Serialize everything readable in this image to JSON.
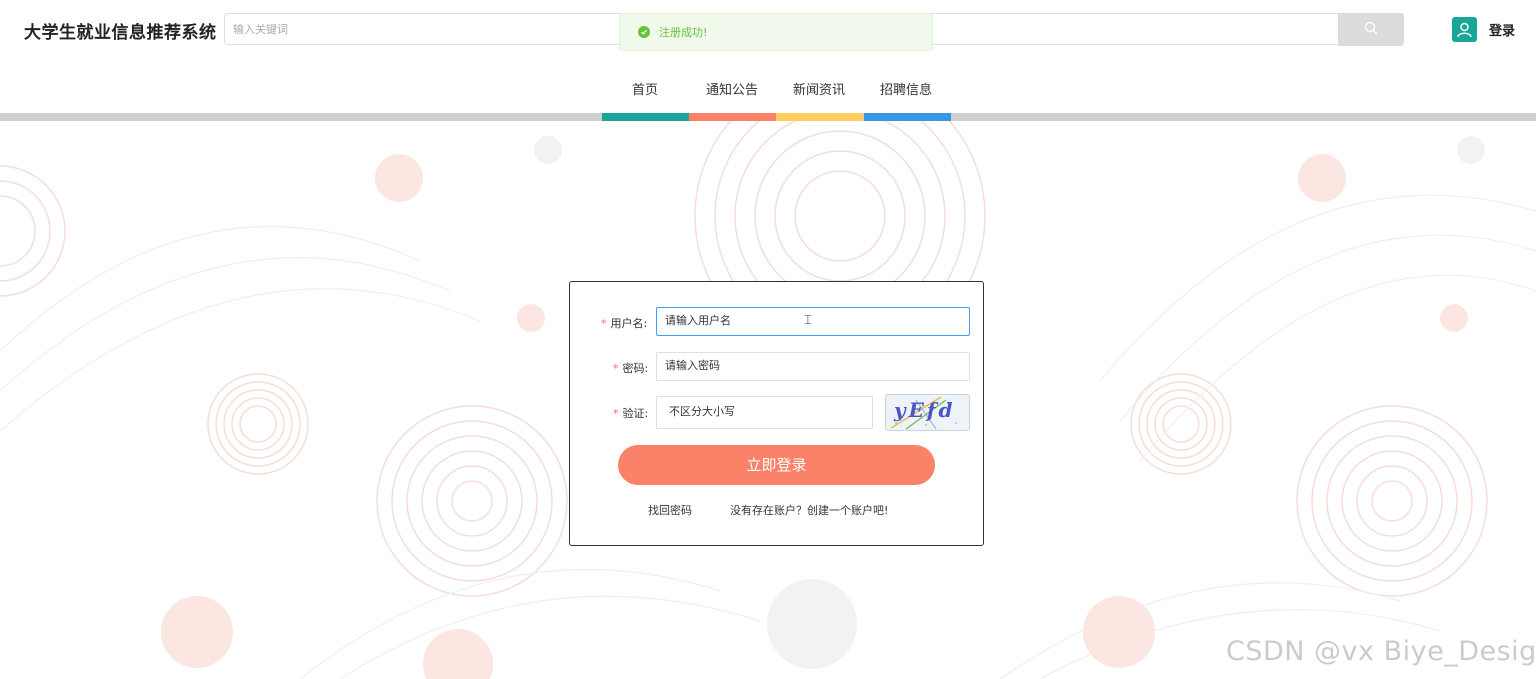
{
  "header": {
    "title": "大学生就业信息推荐系统",
    "search_placeholder": "输入关键词",
    "login_label": "登录"
  },
  "toast": {
    "message": "注册成功!"
  },
  "nav": {
    "items": [
      {
        "label": "首页",
        "color": "#19a699"
      },
      {
        "label": "通知公告",
        "color": "#fa8268"
      },
      {
        "label": "新闻资讯",
        "color": "#ffce5f"
      },
      {
        "label": "招聘信息",
        "color": "#3597e6"
      }
    ]
  },
  "login_form": {
    "username_label": "用户名:",
    "username_placeholder": "请输入用户名",
    "password_label": "密码:",
    "password_placeholder": "请输入密码",
    "captcha_label": "验证:",
    "captcha_placeholder": "不区分大小写",
    "captcha_code": "yEfd",
    "submit_label": "立即登录",
    "forgot_password": "找回密码",
    "register_prompt": "没有存在账户？创建一个账户吧!"
  },
  "watermark": "CSDN @vx Biye_Design",
  "colors": {
    "accent_teal": "#19a699",
    "button": "#fa8268",
    "success": "#67c23a"
  }
}
